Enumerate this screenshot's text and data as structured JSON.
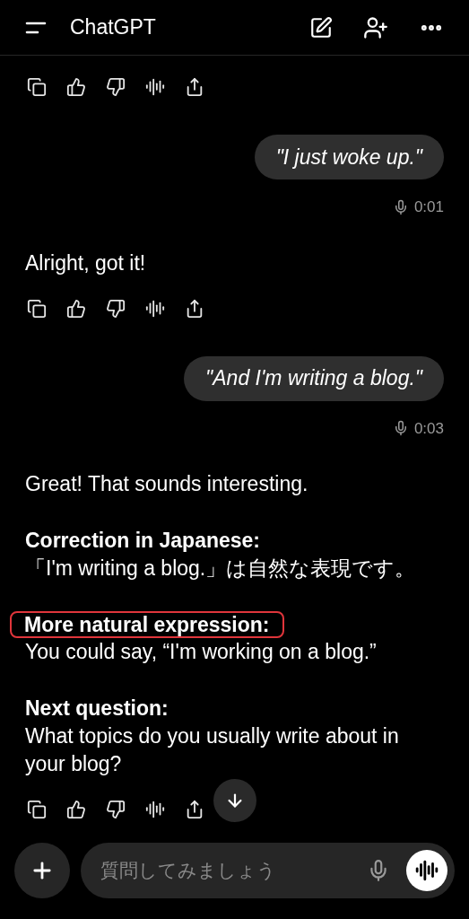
{
  "header": {
    "title": "ChatGPT"
  },
  "messages": [
    {
      "kind": "toolbar"
    },
    {
      "kind": "user",
      "text": "\"I just woke up.\"",
      "duration": "0:01"
    },
    {
      "kind": "assistant",
      "sections": [
        {
          "body": "Alright, got it!",
          "highlighted": false
        }
      ]
    },
    {
      "kind": "toolbar"
    },
    {
      "kind": "user",
      "text": "\"And I'm writing a blog.\"",
      "duration": "0:03"
    },
    {
      "kind": "assistant",
      "sections": [
        {
          "body": "Great! That sounds interesting.",
          "highlighted": false
        },
        {
          "heading": "Correction in Japanese:",
          "body": "「I'm writing a blog.」は自然な表現です。",
          "highlighted": false
        },
        {
          "heading": "More natural expression:",
          "body": "You could say, “I'm working on a blog.”",
          "highlighted": true
        },
        {
          "heading": "Next question:",
          "body": "What topics do you usually write about in your blog?",
          "highlighted": false
        }
      ]
    },
    {
      "kind": "toolbar"
    }
  ],
  "composer": {
    "placeholder": "質問してみましょう"
  }
}
